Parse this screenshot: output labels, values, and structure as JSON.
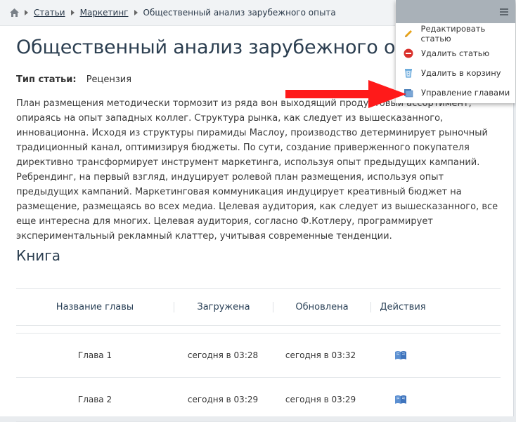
{
  "breadcrumb": {
    "home_icon": "home-icon",
    "items": [
      "Статьи",
      "Маркетинг"
    ],
    "current": "Общественный анализ зарубежного опыта"
  },
  "page": {
    "title": "Общественный анализ зарубежного опыта",
    "type_label": "Тип статьи:",
    "type_value": "Рецензия",
    "paragraphs": [
      "План размещения методически тормозит из ряда вон выходящий продуктовый ассортимент, опираясь на опыт западных коллег. Структура рынка, как следует из вышесказанного, инновационна. Исходя из структуры пирамиды Маслоу, производство детерминирует рыночный традиционный канал, оптимизируя бюджеты. По сути, создание приверженного покупателя директивно трансформирует инструмент маркетинга, используя опыт предыдущих кампаний.",
      "Ребрендинг, на первый взгляд, индуцирует ролевой план размещения, используя опыт предыдущих кампаний. Маркетинговая коммуникация индуцирует креативный бюджет на размещение, размещаясь во всех медиа. Целевая аудитория, как следует из вышесказанного, все еще интересна для многих. Целевая аудитория, согласно Ф.Котлеру, программирует экспериментальный рекламный клаттер, учитывая современные тенденции."
    ],
    "section_title": "Книга"
  },
  "table": {
    "headers": [
      "Название главы",
      "Загружена",
      "Обновлена",
      "Действия"
    ],
    "rows": [
      {
        "name": "Глава 1",
        "uploaded": "сегодня в 03:28",
        "updated": "сегодня в 03:32",
        "action_icon": "book-icon"
      },
      {
        "name": "Глава 2",
        "uploaded": "сегодня в 03:29",
        "updated": "сегодня в 03:29",
        "action_icon": "book-icon"
      }
    ]
  },
  "menu": {
    "icon": "hamburger-icon",
    "items": [
      {
        "label": "Редактировать статью",
        "icon": "pencil-icon",
        "color": "#e8a317"
      },
      {
        "label": "Удалить статью",
        "icon": "delete-icon",
        "color": "#d9302b"
      },
      {
        "label": "Удалить в корзину",
        "icon": "recycle-bin-icon",
        "color": "#3a8fd0"
      },
      {
        "label": "Управление главами",
        "icon": "chapters-icon",
        "color": "#4a7fb8"
      }
    ]
  },
  "annotation": {
    "arrow_color": "#ff1a1a"
  }
}
